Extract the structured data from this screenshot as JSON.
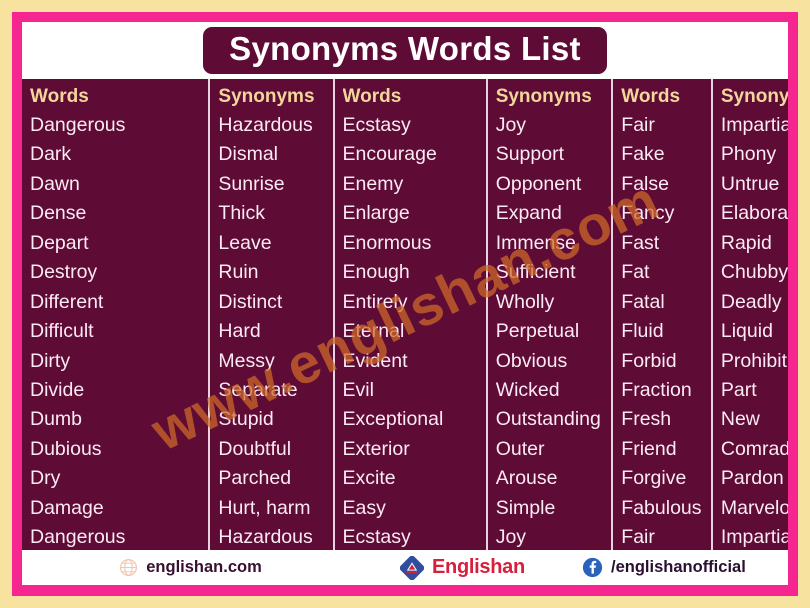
{
  "title": "Synonyms Words List",
  "watermark": "www.englishan.com",
  "colors": {
    "outer_background": "#f8e2a0",
    "frame_pink": "#f5268f",
    "table_maroon": "#5e0b35",
    "header_gold": "#f2d79b",
    "cell_text": "#fbeaf3",
    "watermark_orange": "#cf6a28",
    "brand_red": "#d61f3c",
    "facebook_blue": "#2a62bc"
  },
  "table": {
    "headers": [
      "Words",
      "Synonyms",
      "Words",
      "Synonyms",
      "Words",
      "Synonyms"
    ],
    "columns": [
      {
        "header": "Words",
        "items": [
          "Dangerous",
          "Dark",
          "Dawn",
          "Dense",
          "Depart",
          "Destroy",
          "Different",
          "Difficult",
          "Dirty",
          "Divide",
          "Dumb",
          "Dubious",
          "Dry",
          "Damage",
          "Dangerous"
        ]
      },
      {
        "header": "Synonyms",
        "items": [
          "Hazardous",
          "Dismal",
          "Sunrise",
          "Thick",
          "Leave",
          "Ruin",
          "Distinct",
          "Hard",
          "Messy",
          "Separate",
          "Stupid",
          "Doubtful",
          "Parched",
          "Hurt, harm",
          "Hazardous"
        ]
      },
      {
        "header": "Words",
        "items": [
          "Ecstasy",
          "Encourage",
          "Enemy",
          "Enlarge",
          "Enormous",
          "Enough",
          "Entirely",
          "Eternal",
          "Evident",
          "Evil",
          "Exceptional",
          "Exterior",
          "Excite",
          "Easy",
          "Ecstasy"
        ]
      },
      {
        "header": "Synonyms",
        "items": [
          "Joy",
          "Support",
          "Opponent",
          "Expand",
          "Immense",
          "Sufficient",
          "Wholly",
          "Perpetual",
          "Obvious",
          "Wicked",
          "Outstanding",
          "Outer",
          "Arouse",
          "Simple",
          "Joy"
        ]
      },
      {
        "header": "Words",
        "items": [
          "Fair",
          "Fake",
          "False",
          "Fancy",
          "Fast",
          "Fat",
          "Fatal",
          "Fluid",
          "Forbid",
          "Fraction",
          "Fresh",
          "Friend",
          "Forgive",
          "Fabulous",
          "Fair"
        ]
      },
      {
        "header": "Synonyms",
        "items": [
          "Impartial",
          "Phony",
          "Untrue",
          "Elaborate",
          "Rapid",
          "Chubby",
          "Deadly",
          "Liquid",
          "Prohibit",
          "Part",
          "New",
          "Comrade",
          "Pardon",
          "Marvelous",
          "Impartial"
        ]
      }
    ]
  },
  "footer": {
    "website": "englishan.com",
    "website_icon": "globe-icon",
    "brand": "Englishan",
    "brand_icon": "englishan-logo-icon",
    "facebook_handle": "/englishanofficial",
    "facebook_icon": "facebook-icon"
  }
}
